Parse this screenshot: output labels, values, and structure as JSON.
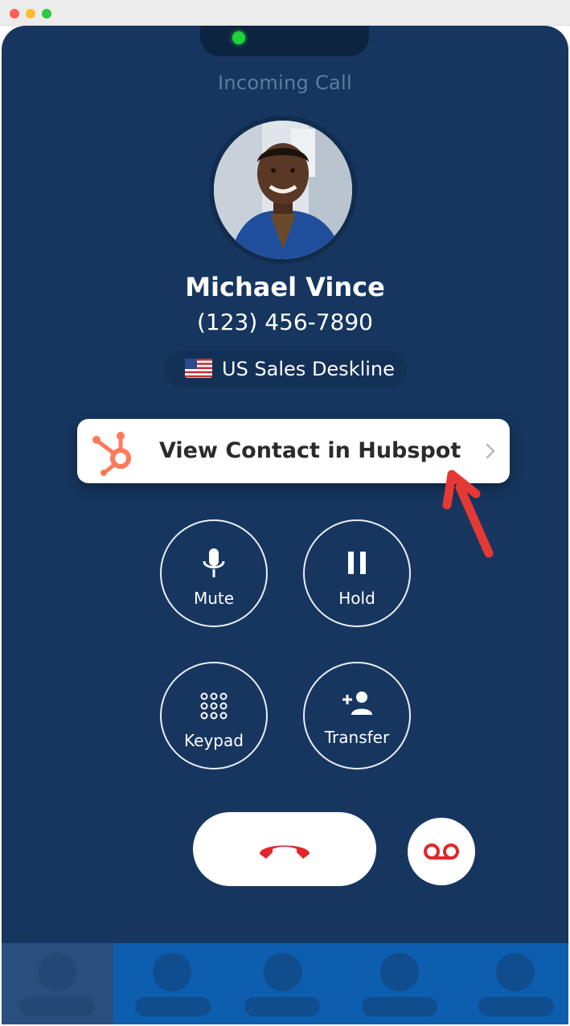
{
  "window": {
    "buttons": [
      "close",
      "minimize",
      "zoom"
    ]
  },
  "call": {
    "status": "Incoming Call",
    "caller_name": "Michael Vince",
    "caller_number": "(123) 456-7890",
    "line": {
      "flag_icon": "us-flag-icon",
      "label": "US Sales Deskline"
    }
  },
  "hubspot": {
    "label": "View Contact in Hubspot",
    "logo_icon": "hubspot-logo-icon",
    "brand_color": "#ff7a59"
  },
  "controls": [
    {
      "label": "Mute",
      "icon": "microphone-icon"
    },
    {
      "label": "Hold",
      "icon": "pause-icon"
    },
    {
      "label": "Keypad",
      "icon": "keypad-icon"
    },
    {
      "label": "Transfer",
      "icon": "add-person-icon"
    }
  ],
  "actions": {
    "end_call_icon": "hang-up-icon",
    "voicemail_icon": "voicemail-icon",
    "danger_color": "#e3262b"
  },
  "annotation": {
    "arrow_color": "#e53935"
  },
  "colors": {
    "background": "#16365f",
    "tab_bar": "#0d5eaf"
  }
}
